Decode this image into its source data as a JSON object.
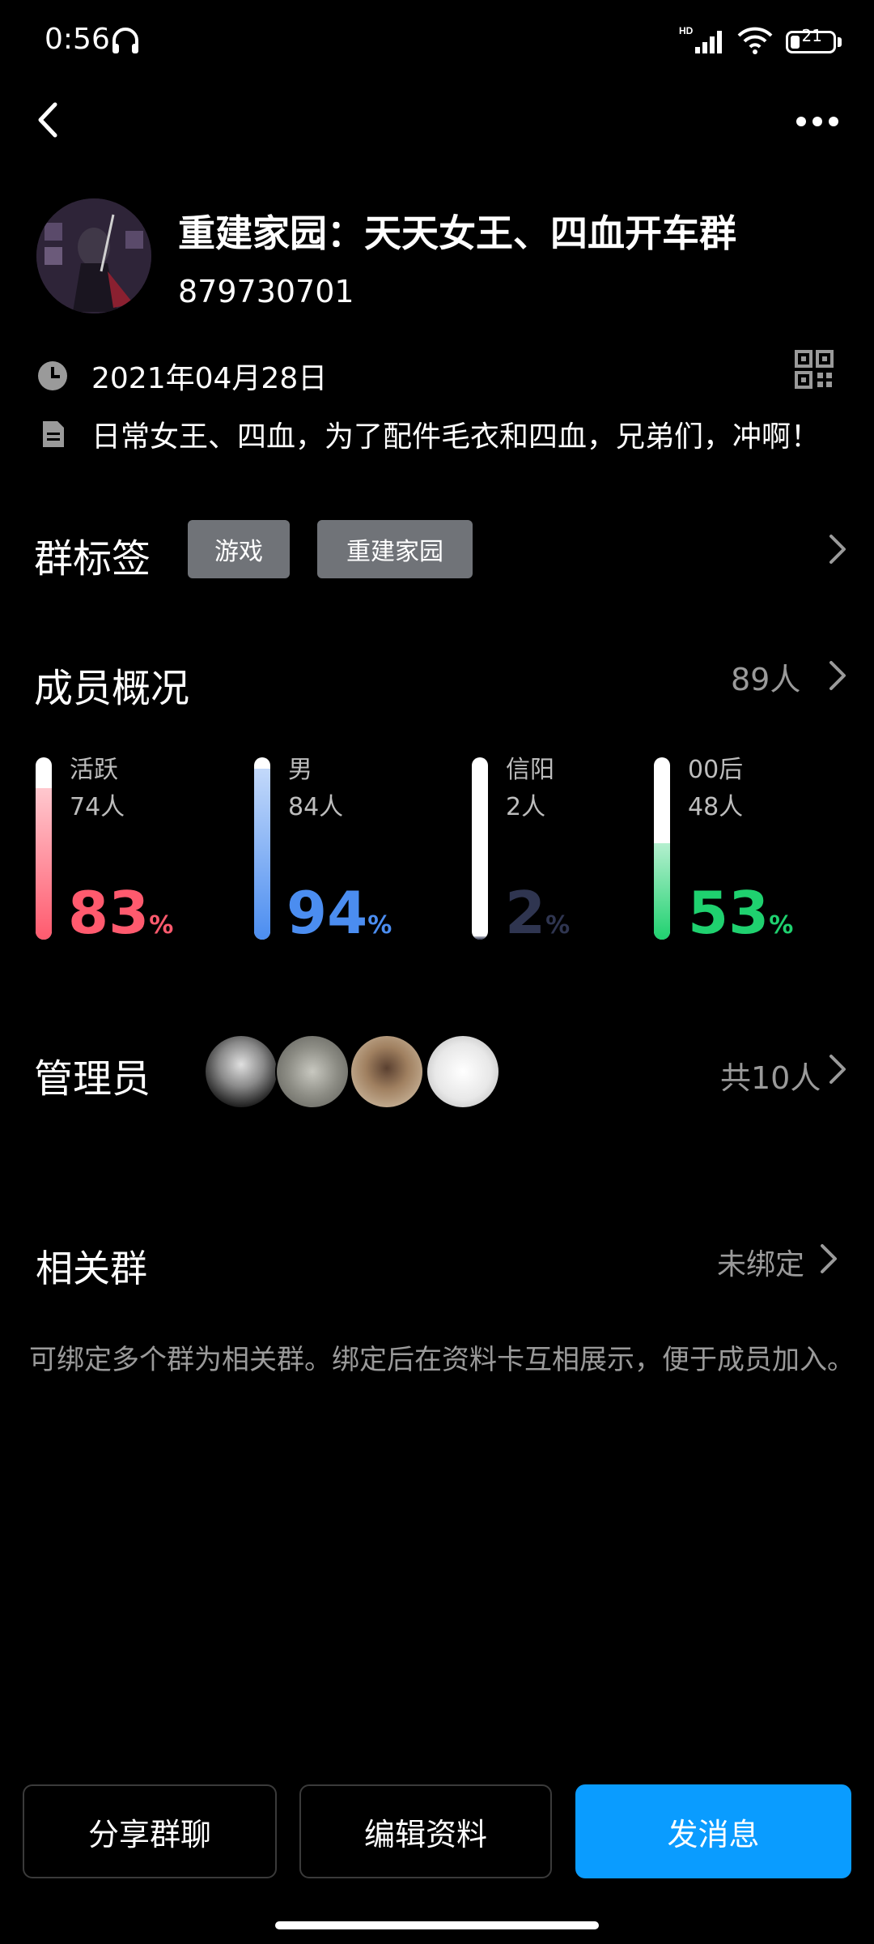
{
  "status_bar": {
    "time": "0:56",
    "battery": "21"
  },
  "group": {
    "name": "重建家园：天天女王、四血开车群",
    "id": "879730701",
    "created_date": "2021年04月28日",
    "intro": "日常女王、四血，为了配件毛衣和四血，兄弟们，冲啊！"
  },
  "tags_section": {
    "title": "群标签",
    "tags": [
      "游戏",
      "重建家园"
    ]
  },
  "members_section": {
    "title": "成员概况",
    "count": "89人",
    "stats": [
      {
        "label": "活跃",
        "count": "74人",
        "percent": "83",
        "unit": "%",
        "color": "#ff5a6e",
        "fill": 0.83
      },
      {
        "label": "男",
        "count": "84人",
        "percent": "94",
        "unit": "%",
        "color": "#4b8df0",
        "fill": 0.94
      },
      {
        "label": "信阳",
        "count": "2人",
        "percent": "2",
        "unit": "%",
        "color": "#2f3550",
        "fill": 0.02
      },
      {
        "label": "00后",
        "count": "48人",
        "percent": "53",
        "unit": "%",
        "color": "#1fd16f",
        "fill": 0.53
      }
    ]
  },
  "admins_section": {
    "title": "管理员",
    "total": "共10人"
  },
  "related_section": {
    "title": "相关群",
    "status": "未绑定",
    "description": "可绑定多个群为相关群。绑定后在资料卡互相展示，便于成员加入。"
  },
  "actions": {
    "share": "分享群聊",
    "edit": "编辑资料",
    "message": "发消息"
  },
  "colors": {
    "primary": "#0a9cff",
    "tag_bg": "#707378"
  }
}
